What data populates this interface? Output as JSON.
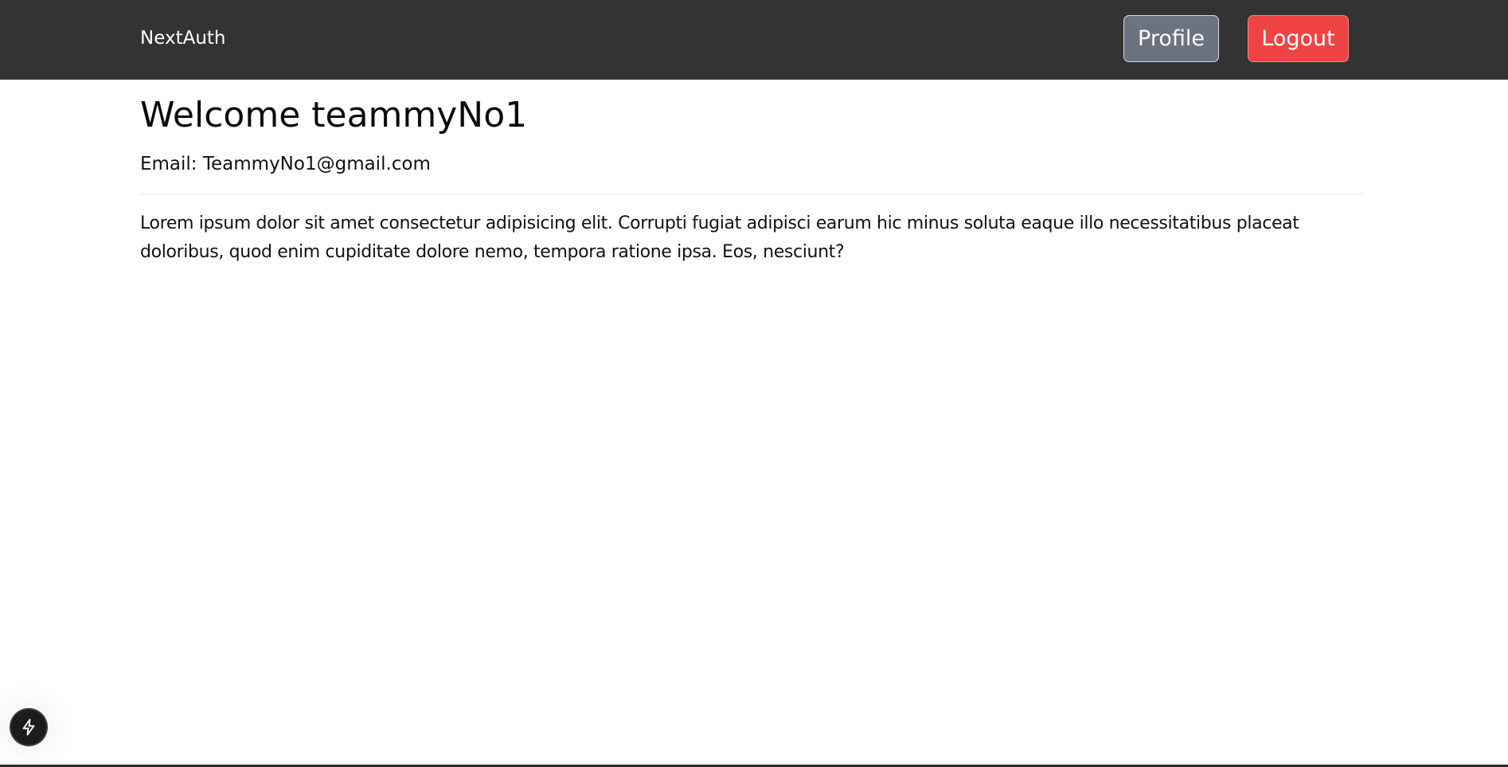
{
  "navbar": {
    "brand": "NextAuth",
    "profile_label": "Profile",
    "logout_label": "Logout"
  },
  "main": {
    "welcome": "Welcome teammyNo1",
    "email_line": "Email: TeammyNo1@gmail.com",
    "paragraph": "Lorem ipsum dolor sit amet consectetur adipisicing elit. Corrupti fugiat adipisci earum hic minus soluta eaque illo necessitatibus placeat doloribus, quod enim cupiditate dolore nemo, tempora ratione ipsa. Eos, nesciunt?"
  },
  "dev_indicator": {
    "icon": "lightning-bolt-icon"
  },
  "colors": {
    "navbar_bg": "#333333",
    "profile_button": "#6b7280",
    "logout_button": "#ef4444"
  }
}
